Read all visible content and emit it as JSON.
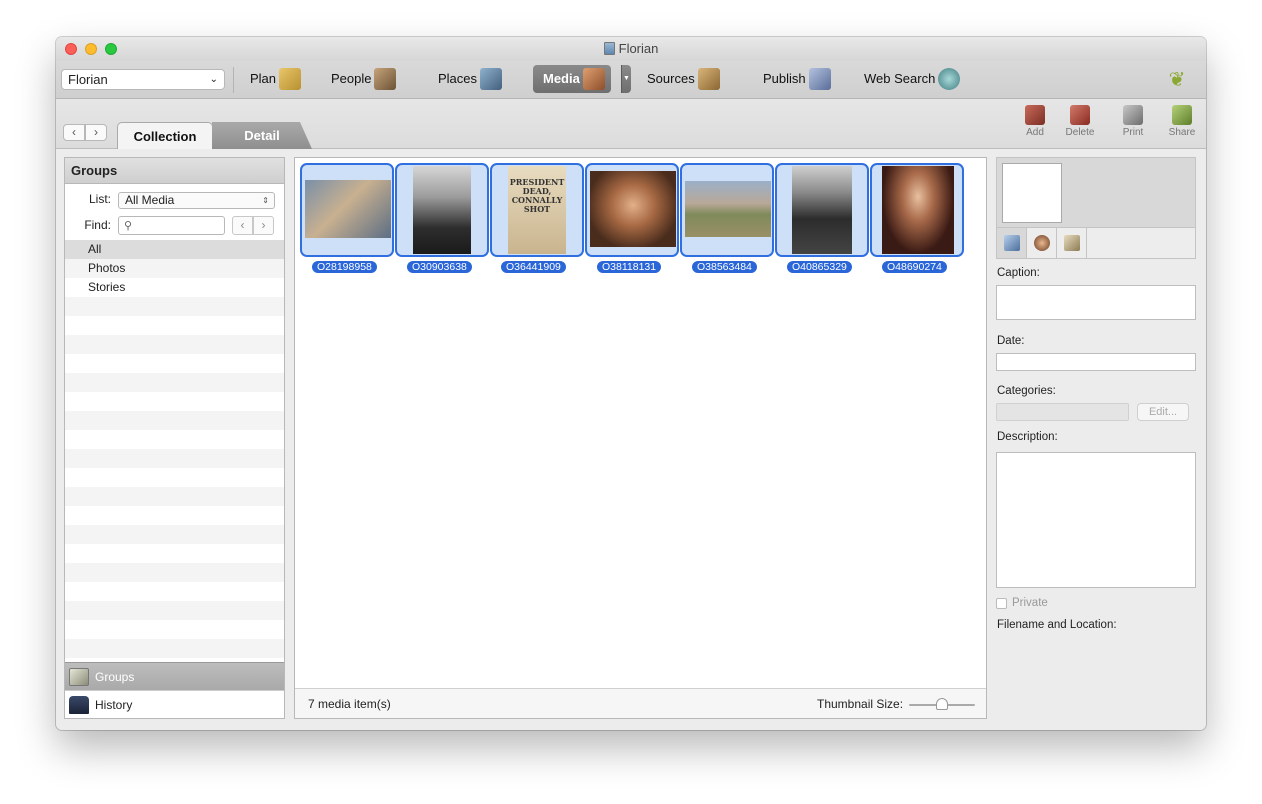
{
  "window": {
    "title": "Florian"
  },
  "toolbar": {
    "tree_select": "Florian",
    "items": [
      {
        "label": "Plan",
        "icon": "plan-icon",
        "color": "#c9a24a"
      },
      {
        "label": "People",
        "icon": "people-icon",
        "color": "#8a6d4a"
      },
      {
        "label": "Places",
        "icon": "places-icon",
        "color": "#5e7f9e"
      },
      {
        "label": "Media",
        "icon": "media-icon",
        "color": "#b07040",
        "active": true
      },
      {
        "label": "Sources",
        "icon": "sources-icon",
        "color": "#b48a4c"
      },
      {
        "label": "Publish",
        "icon": "publish-icon",
        "color": "#6c7fa8"
      },
      {
        "label": "Web Search",
        "icon": "web-search-icon",
        "color": "#4f8a8f"
      }
    ]
  },
  "subbar": {
    "tabs": {
      "collection": "Collection",
      "detail": "Detail"
    },
    "actions": {
      "add": "Add",
      "delete": "Delete",
      "print": "Print",
      "share": "Share"
    }
  },
  "groups_panel": {
    "title": "Groups",
    "list_label": "List:",
    "list_value": "All Media",
    "find_label": "Find:",
    "find_placeholder": "",
    "items": [
      "All",
      "Photos",
      "Stories"
    ],
    "footer": {
      "groups": "Groups",
      "history": "History"
    }
  },
  "media": {
    "items": [
      "O28198958",
      "O30903638",
      "O36441909",
      "O38118131",
      "O38563484",
      "O40865329",
      "O48690274"
    ],
    "count_label": "7 media item(s)",
    "thumb_size_label": "Thumbnail Size:",
    "thumb_size_level": 0.5
  },
  "detail_panel": {
    "caption_label": "Caption:",
    "date_label": "Date:",
    "categories_label": "Categories:",
    "edit_button": "Edit...",
    "description_label": "Description:",
    "private_label": "Private",
    "filename_label": "Filename and Location:"
  },
  "colors": {
    "selection_blue": "#2a66d8",
    "thumb_bg": "#cde0f7",
    "leaf_green": "#8aa832"
  }
}
